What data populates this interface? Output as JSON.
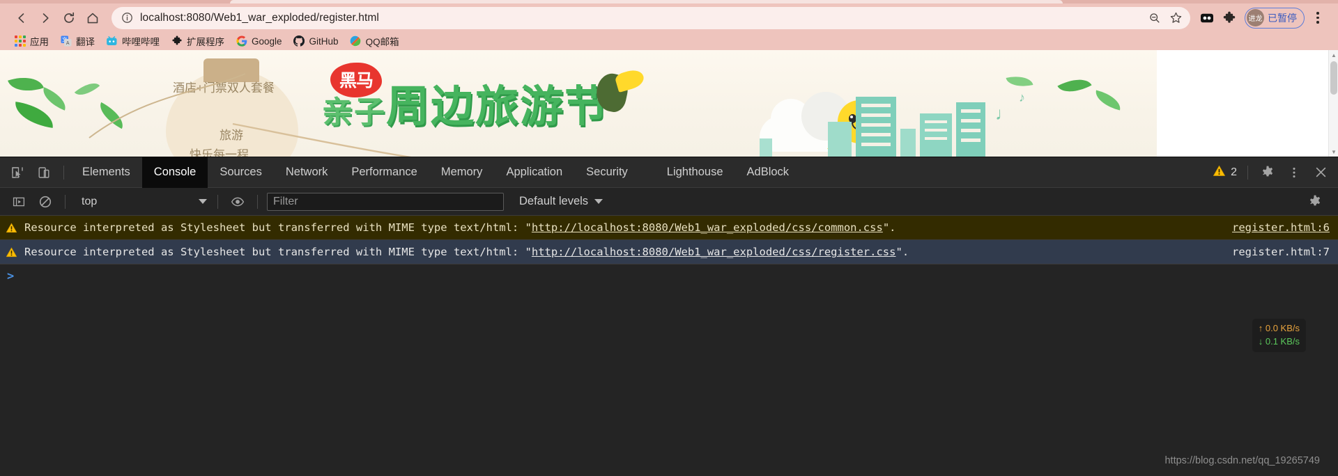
{
  "browser": {
    "nav": {
      "back": "back-arrow",
      "forward": "forward-arrow",
      "reload": "reload",
      "home": "home"
    },
    "omnibox": {
      "info_icon": "info-circle-icon",
      "url": "localhost:8080/Web1_war_exploded/register.html",
      "zoom_out_icon": "zoom-out-icon",
      "bookmark_icon": "star-icon"
    },
    "extensions": [
      {
        "name": "adblock-extension-icon",
        "label": ""
      },
      {
        "name": "puzzle-extensions-icon",
        "label": ""
      }
    ],
    "profile": {
      "avatar_initials": "进龙",
      "label": "已暂停"
    },
    "menu": "chrome-menu-icon",
    "bookmarks": [
      {
        "label": "应用",
        "icon": "apps-grid-icon"
      },
      {
        "label": "翻译",
        "icon": "google-translate-icon"
      },
      {
        "label": "哔哩哔哩",
        "icon": "bilibili-icon"
      },
      {
        "label": "扩展程序",
        "icon": "puzzle-icon"
      },
      {
        "label": "Google",
        "icon": "google-icon"
      },
      {
        "label": "GitHub",
        "icon": "github-icon"
      },
      {
        "label": "QQ邮箱",
        "icon": "qqmail-icon"
      }
    ]
  },
  "page": {
    "banner": {
      "brand_badge": "黑马",
      "title_main": "周边旅游节",
      "title_prefix": "亲子",
      "bean_line1": "酒店+门票双人套餐",
      "bean_line2": "旅游",
      "bean_line3": "快乐每一程"
    },
    "scrollbar": {
      "up_arrow": "▲",
      "down_arrow": "▼"
    }
  },
  "devtools": {
    "toolbar_icons": {
      "inspect": "inspect-element-icon",
      "device": "device-toolbar-icon"
    },
    "tabs": [
      {
        "label": "Elements",
        "active": false
      },
      {
        "label": "Console",
        "active": true
      },
      {
        "label": "Sources",
        "active": false
      },
      {
        "label": "Network",
        "active": false
      },
      {
        "label": "Performance",
        "active": false
      },
      {
        "label": "Memory",
        "active": false
      },
      {
        "label": "Application",
        "active": false
      },
      {
        "label": "Security",
        "active": false
      },
      {
        "label": "Lighthouse",
        "active": false
      },
      {
        "label": "AdBlock",
        "active": false
      }
    ],
    "warning_count": "2",
    "right_icons": {
      "settings": "gear-icon",
      "more": "kebab-menu-icon",
      "close": "close-icon"
    },
    "filterbar": {
      "sidebar_toggle": "console-sidebar-icon",
      "clear_console": "clear-console-icon",
      "context": "top",
      "eye_icon": "live-expression-eye-icon",
      "filter_placeholder": "Filter",
      "filter_value": "",
      "levels": "Default levels",
      "settings_icon": "gear-icon"
    },
    "console": {
      "messages": [
        {
          "level": "warning",
          "selected": false,
          "prefix": "Resource interpreted as Stylesheet but transferred with MIME type text/html: \"",
          "url": "http://localhost:8080/Web1_war_exploded/css/common.css",
          "suffix": "\".",
          "source": "register.html:6"
        },
        {
          "level": "warning",
          "selected": true,
          "prefix": "Resource interpreted as Stylesheet but transferred with MIME type text/html: \"",
          "url": "http://localhost:8080/Web1_war_exploded/css/register.css",
          "suffix": "\".",
          "source": "register.html:7"
        }
      ],
      "prompt": ">"
    },
    "network_badge": {
      "upload": "↑ 0.0 KB/s",
      "download": "↓ 0.1 KB/s"
    },
    "watermark": "https://blog.csdn.net/qq_19265749"
  },
  "colors": {
    "chrome_bg": "#eec4bd",
    "devtools_bg": "#242424",
    "warning_bg": "#332b00",
    "selected_bg": "#313b4d",
    "accent_blue": "#4a90e2",
    "banner_green": "#46b45e"
  }
}
